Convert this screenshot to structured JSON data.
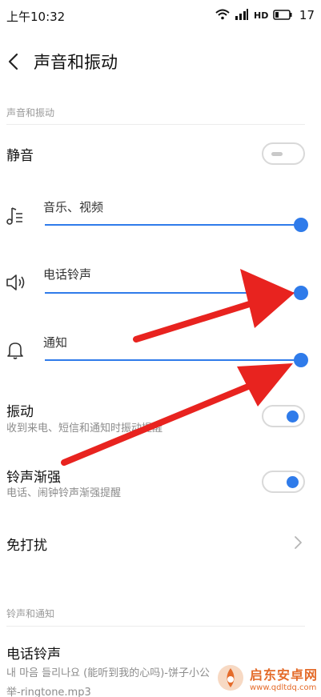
{
  "status_bar": {
    "time": "上午10:32",
    "battery_level": "17"
  },
  "header": {
    "title": "声音和振动"
  },
  "section1": {
    "header": "声音和振动"
  },
  "mute": {
    "label": "静音",
    "enabled": false
  },
  "volume": [
    {
      "label": "音乐、视频",
      "icon": "music-list-icon",
      "level": 1.0
    },
    {
      "label": "电话铃声",
      "icon": "speaker-icon",
      "level": 1.0
    },
    {
      "label": "通知",
      "icon": "bell-icon",
      "level": 1.0
    }
  ],
  "vibration": {
    "label": "振动",
    "sublabel": "收到来电、短信和通知时振动提醒",
    "enabled": true
  },
  "ring_crescendo": {
    "label": "铃声渐强",
    "sublabel": "电话、闹钟铃声渐强提醒",
    "enabled": true
  },
  "dnd": {
    "label": "免打扰"
  },
  "section2": {
    "header": "铃声和通知"
  },
  "ringtone": {
    "label": "电话铃声",
    "value_line1": "내 마음 들리나요 (能听到我的心吗)-饼子小公",
    "value_line2": "举-ringtone.mp3"
  },
  "watermark": {
    "name": "启东安卓网",
    "url": "www.qdltdq.com"
  },
  "colors": {
    "accent": "#2f7bea",
    "arrow": "#e8231f",
    "watermark": "#e46b2a"
  }
}
